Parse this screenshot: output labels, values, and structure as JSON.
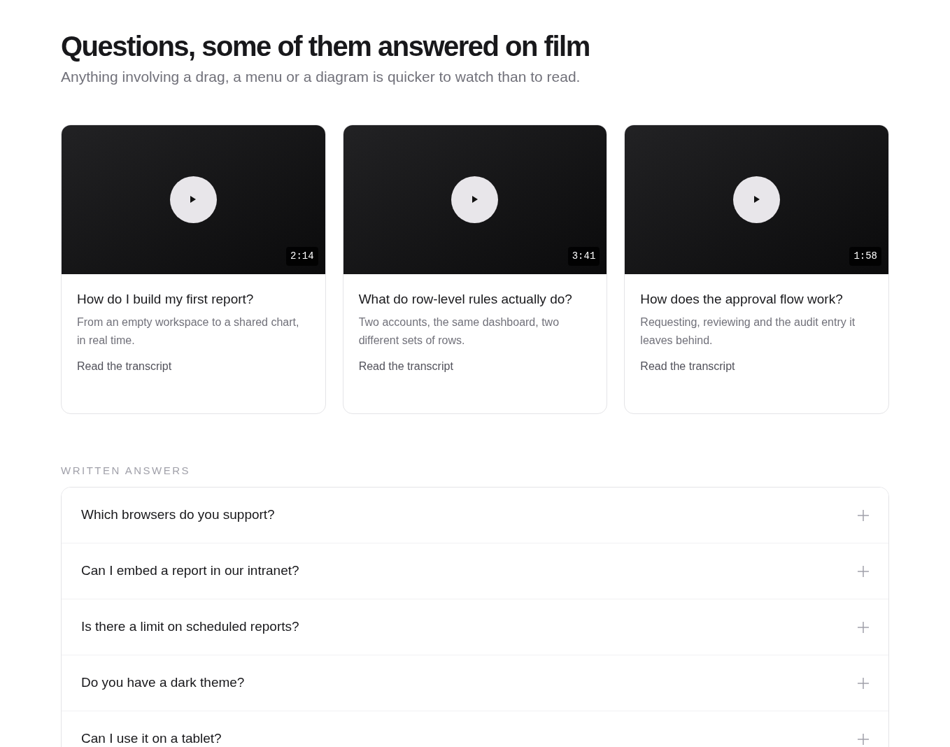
{
  "header": {
    "title": "Questions, some of them answered on film",
    "subtitle": "Anything involving a drag, a menu or a diagram is quicker to watch than to read."
  },
  "videos": [
    {
      "duration": "2:14",
      "title": "How do I build my first report?",
      "description": "From an empty workspace to a shared chart, in real time.",
      "link": "Read the transcript"
    },
    {
      "duration": "3:41",
      "title": "What do row-level rules actually do?",
      "description": "Two accounts, the same dashboard, two different sets of rows.",
      "link": "Read the transcript"
    },
    {
      "duration": "1:58",
      "title": "How does the approval flow work?",
      "description": "Requesting, reviewing and the audit entry it leaves behind.",
      "link": "Read the transcript"
    }
  ],
  "written_answers": {
    "label": "WRITTEN ANSWERS",
    "items": [
      {
        "question": "Which browsers do you support?",
        "expanded": false
      },
      {
        "question": "Can I embed a report in our intranet?",
        "expanded": false
      },
      {
        "question": "Is there a limit on scheduled reports?",
        "expanded": false
      },
      {
        "question": "Do you have a dark theme?",
        "expanded": false
      },
      {
        "question": "Can I use it on a tablet?",
        "expanded": false
      }
    ]
  }
}
